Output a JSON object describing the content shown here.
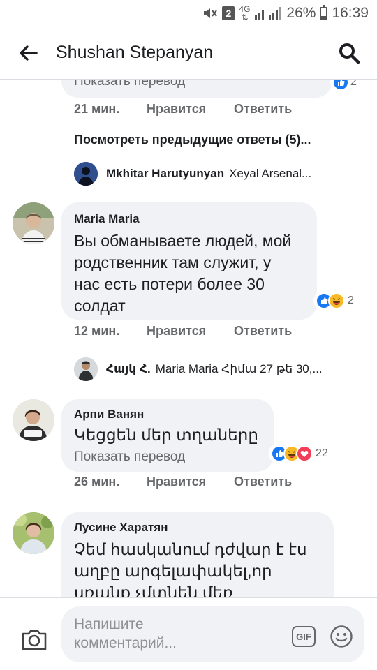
{
  "status": {
    "sim_badge": "2",
    "network": "4G",
    "battery": "26%",
    "time": "16:39"
  },
  "header": {
    "title": "Shushan Stepanyan"
  },
  "top_comment": {
    "translate": "Показать перевод",
    "reaction_count": "2",
    "time": "21 мин.",
    "like": "Нравится",
    "reply": "Ответить"
  },
  "previous_replies": "Посмотреть предыдущие ответы (5)...",
  "reply_preview_1": {
    "name": "Mkhitar Harutyunyan",
    "text": "Xeyal Arsenal..."
  },
  "comments": [
    {
      "author": "Maria Maria",
      "text_lines": [
        "Вы обманываете людей, мой",
        "родственник там служит, у",
        "нас есть потери более 30",
        "солдат"
      ],
      "reaction_count": "2",
      "time": "12 мин.",
      "like": "Нравится",
      "reply": "Ответить"
    },
    {
      "author": "Арпи Ванян",
      "text_lines": [
        "Կեցցեն մեր տղաները"
      ],
      "translate": "Показать перевод",
      "reaction_count": "22",
      "time": "26 мин.",
      "like": "Нравится",
      "reply": "Ответить"
    },
    {
      "author": "Лусине Харатян",
      "text_lines": [
        "Չեմ հասկանում դժվար է էս",
        "աղբը արգելափակել,որ",
        "սռանք չմտնեն մեռ"
      ]
    }
  ],
  "reply_preview_2": {
    "name": "Հայկ Հ.",
    "text": "Maria Maria Հիմա 27 թե 30,..."
  },
  "composer": {
    "placeholder": "Напишите комментарий...",
    "gif": "GIF"
  },
  "colors": {
    "like_blue": "#1877f2",
    "haha_yellow": "#f7b928",
    "love_red": "#f33e58",
    "bubble_gray": "#f0f2f5"
  }
}
